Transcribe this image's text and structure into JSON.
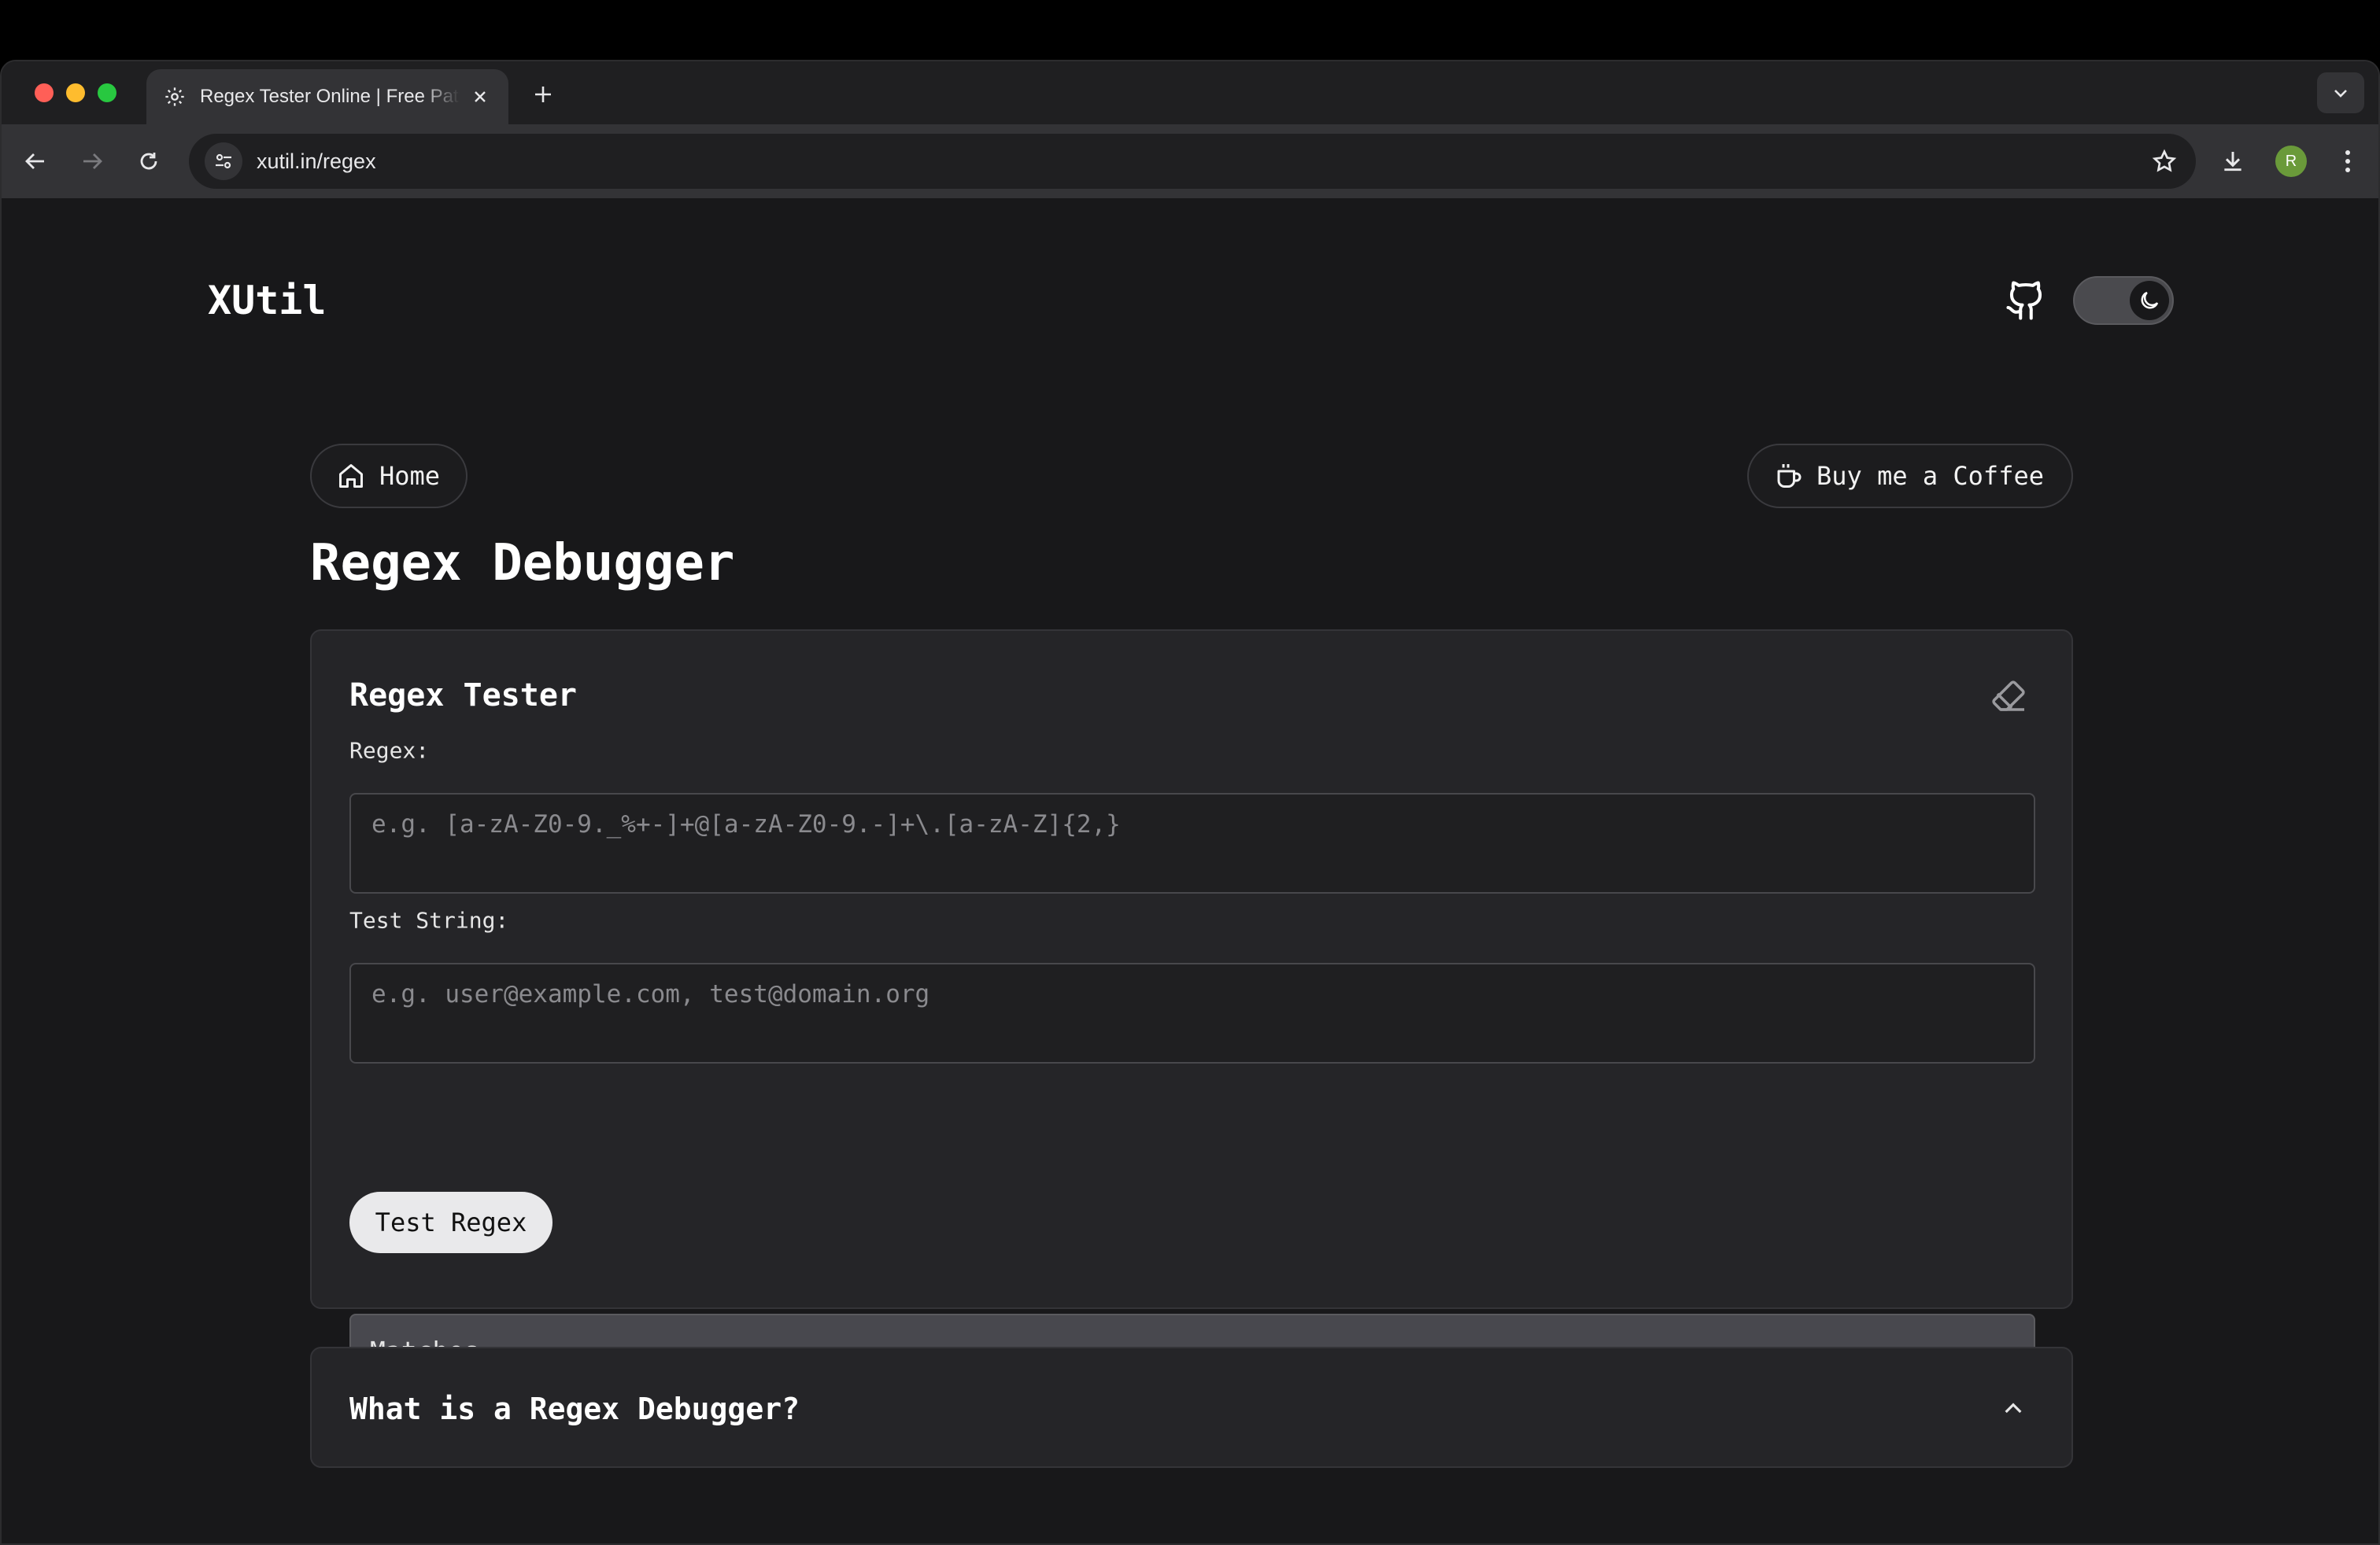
{
  "browser": {
    "tab_title": "Regex Tester Online | Free Pattern",
    "url": "xutil.in/regex",
    "profile_initial": "R"
  },
  "site": {
    "brand": "XUtil"
  },
  "nav": {
    "home_label": "Home",
    "coffee_label": "Buy me a Coffee"
  },
  "page": {
    "title": "Regex Debugger"
  },
  "tester": {
    "title": "Regex Tester",
    "regex_label": "Regex:",
    "regex_placeholder": "e.g. [a-zA-Z0-9._%+-]+@[a-zA-Z0-9.-]+\\.[a-zA-Z]{2,}",
    "test_label": "Test String:",
    "test_placeholder": "e.g. user@example.com, test@domain.org",
    "button_label": "Test Regex",
    "matches_label": "Matches"
  },
  "faq": {
    "question": "What is a Regex Debugger?"
  }
}
